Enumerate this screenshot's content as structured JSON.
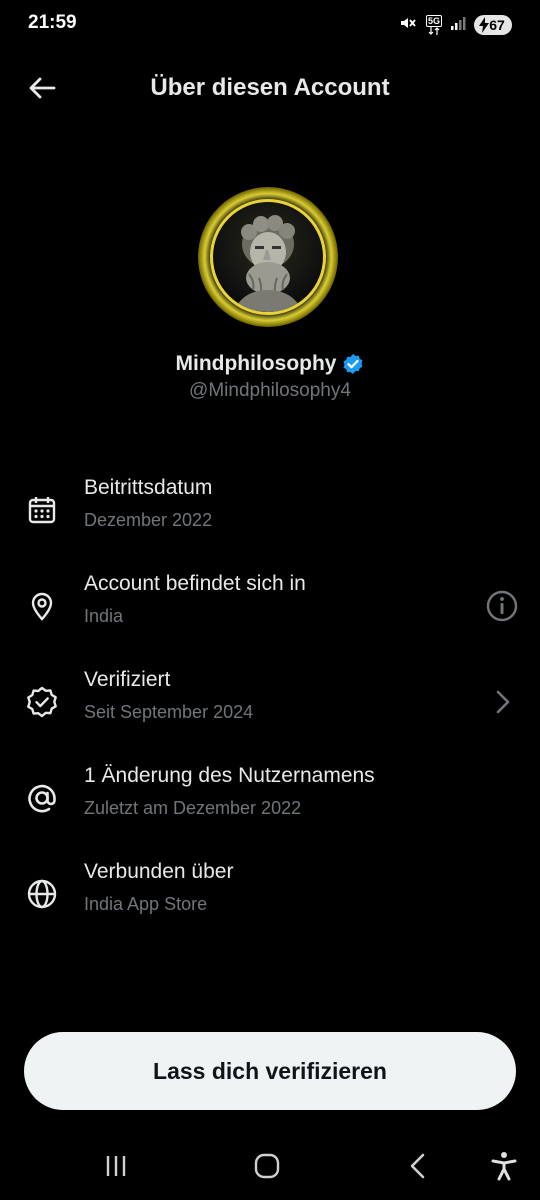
{
  "status_bar": {
    "time": "21:59",
    "network": "5G",
    "battery": "67",
    "icons": [
      "mute-icon",
      "5g-icon",
      "signal-icon",
      "battery-icon"
    ]
  },
  "header": {
    "title": "Über diesen Account",
    "back_icon": "arrow-left-icon"
  },
  "profile": {
    "display_name": "Mindphilosophy",
    "handle": "@Mindphilosophy4",
    "verified_badge_color": "#1d9bf0",
    "avatar_ring_color": "#e8d43a"
  },
  "info_items": [
    {
      "icon": "calendar-icon",
      "title": "Beitrittsdatum",
      "subtitle": "Dezember 2022"
    },
    {
      "icon": "location-pin-icon",
      "title": "Account befindet sich in",
      "subtitle": "India",
      "action_icon": "info-icon"
    },
    {
      "icon": "verified-badge-icon",
      "title": "Verifiziert",
      "subtitle": "Seit September 2024",
      "action_icon": "chevron-right-icon"
    },
    {
      "icon": "at-sign-icon",
      "title": "1 Änderung des Nutzernamens",
      "subtitle": "Zuletzt am Dezember 2022"
    },
    {
      "icon": "globe-icon",
      "title": "Verbunden über",
      "subtitle": "India App Store"
    }
  ],
  "cta": {
    "label": "Lass dich verifizieren"
  },
  "nav_bar": {
    "icons": [
      "recent-apps-icon",
      "home-icon",
      "back-icon",
      "accessibility-icon"
    ]
  },
  "colors": {
    "background": "#000000",
    "primary_text": "#e7e9ea",
    "secondary_text": "#71767b",
    "button_bg": "#eff3f4"
  }
}
